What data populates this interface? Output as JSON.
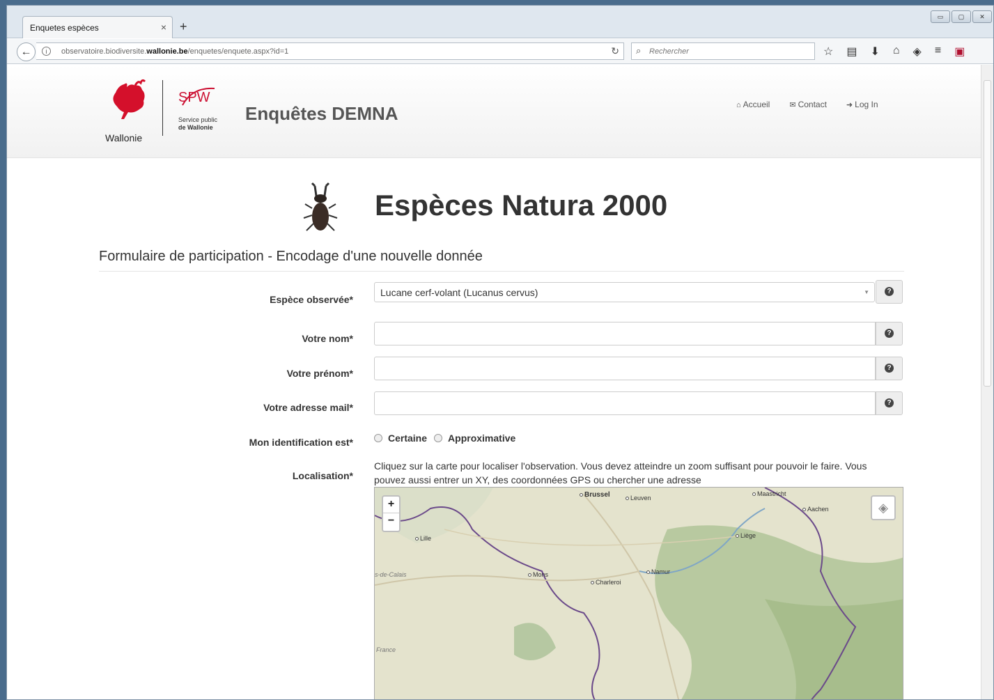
{
  "browser": {
    "tab_title": "Enquetes espèces",
    "tab_close": "×",
    "new_tab": "+",
    "url_prefix": "observatoire.biodiversite.",
    "url_domain": "wallonie.be",
    "url_path": "/enquetes/enquete.aspx?id=1",
    "search_placeholder": "Rechercher",
    "window_buttons": [
      "▭",
      "▢",
      "✕"
    ],
    "icons": [
      "star-icon",
      "reading-list-icon",
      "download-icon",
      "home-icon",
      "pocket-icon",
      "menu-icon",
      "extension-icon"
    ]
  },
  "header": {
    "logo_region": "Wallonie",
    "logo_spw": "SPW",
    "logo_spw_sub1": "Service public",
    "logo_spw_sub2": "de Wallonie",
    "app_title": "Enquêtes DEMNA",
    "nav": {
      "home": "Accueil",
      "contact": "Contact",
      "login": "Log In"
    }
  },
  "main": {
    "hero_title": "Espèces Natura 2000",
    "form_heading": "Formulaire de participation - Encodage d'une nouvelle donnée",
    "fields": {
      "species_label": "Espèce observée*",
      "species_value": "Lucane cerf-volant (Lucanus cervus)",
      "name_label": "Votre nom*",
      "firstname_label": "Votre prénom*",
      "email_label": "Votre adresse mail*",
      "identification_label": "Mon identification est*",
      "identification_options": [
        "Certaine",
        "Approximative"
      ],
      "location_label": "Localisation*",
      "location_help": "Cliquez sur la carte pour localiser l'observation. Vous devez atteindre un zoom suffisant pour pouvoir le faire. Vous pouvez aussi entrer un XY, des coordonnées GPS ou chercher une adresse"
    },
    "map": {
      "zoom_in": "+",
      "zoom_out": "−",
      "cities": [
        "Brussel",
        "Leuven",
        "Maastricht",
        "Aachen",
        "Lille",
        "Liège",
        "Mons",
        "Namur",
        "Charleroi"
      ],
      "regions": [
        "s-de-Calais",
        "France"
      ]
    }
  },
  "colors": {
    "accent_red": "#cc1133",
    "heading": "#333333"
  }
}
